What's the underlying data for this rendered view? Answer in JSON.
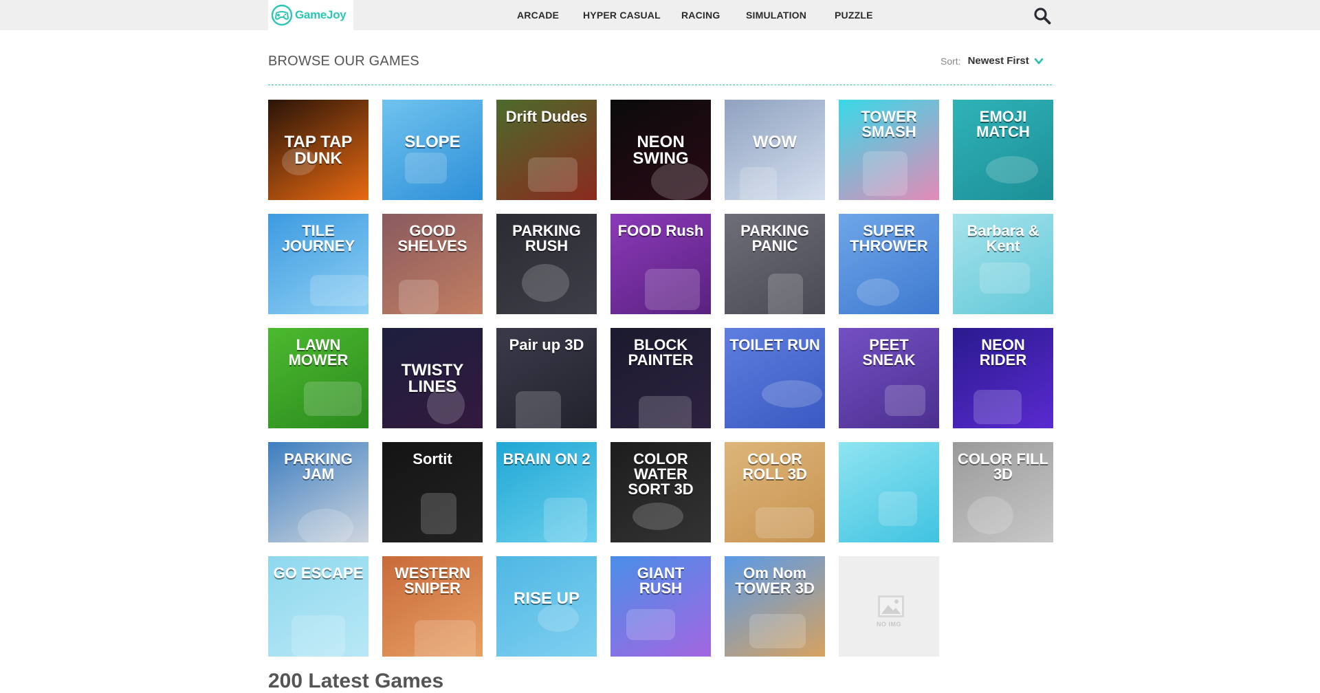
{
  "header": {
    "logo_text": "GameJoy",
    "nav": [
      "ARCADE",
      "HYPER CASUAL",
      "RACING",
      "SIMULATION",
      "PUZZLE"
    ],
    "search_icon": "search-icon"
  },
  "browse": {
    "title": "BROWSE OUR GAMES",
    "sort_label": "Sort:",
    "sort_value": "Newest First"
  },
  "games": [
    {
      "label": "TAP TAP DUNK",
      "bg": "#2a1408",
      "bg2": "#e86a12",
      "style": "mid"
    },
    {
      "label": "SLOPE",
      "bg": "#6fc3ee",
      "bg2": "#2e8fd8",
      "style": "mid"
    },
    {
      "label": "Drift Dudes",
      "bg": "#4c6b2c",
      "bg2": "#8b2a1e",
      "style": "top"
    },
    {
      "label": "NEON SWING",
      "bg": "#0b0b0b",
      "bg2": "#2a0a16",
      "style": "mid"
    },
    {
      "label": "WOW",
      "bg": "#8fa2c0",
      "bg2": "#d6e0ef",
      "style": "mid"
    },
    {
      "label": "TOWER SMASH",
      "bg": "#38d9e8",
      "bg2": "#e38ab6",
      "style": "top"
    },
    {
      "label": "EMOJI MATCH",
      "bg": "#2fb3b8",
      "bg2": "#1c8f96",
      "style": "top"
    },
    {
      "label": "TILE JOURNEY",
      "bg": "#3d9be0",
      "bg2": "#8fd0f4",
      "style": "top"
    },
    {
      "label": "GOOD SHELVES",
      "bg": "#8a5a5f",
      "bg2": "#c27f62",
      "style": "top"
    },
    {
      "label": "PARKING RUSH",
      "bg": "#2b2b33",
      "bg2": "#3e3e48",
      "style": "top"
    },
    {
      "label": "FOOD Rush",
      "bg": "#8b3ab8",
      "bg2": "#5a2180",
      "style": "top"
    },
    {
      "label": "PARKING PANIC",
      "bg": "#6e6e78",
      "bg2": "#4a4a54",
      "style": "top"
    },
    {
      "label": "SUPER THROWER",
      "bg": "#6fa6e8",
      "bg2": "#3e79cf",
      "style": "top"
    },
    {
      "label": "Barbara & Kent",
      "bg": "#a6e3ec",
      "bg2": "#61c8d8",
      "style": "top"
    },
    {
      "label": "LAWN MOWER",
      "bg": "#4cba2f",
      "bg2": "#2b8a1e",
      "style": "top"
    },
    {
      "label": "TWISTY LINES",
      "bg": "#1d1f3e",
      "bg2": "#33193d",
      "style": "mid"
    },
    {
      "label": "Pair up 3D",
      "bg": "#3a3a4a",
      "bg2": "#23232e",
      "style": "top"
    },
    {
      "label": "BLOCK PAINTER",
      "bg": "#1b1a2e",
      "bg2": "#2d2240",
      "style": "top"
    },
    {
      "label": "TOILET RUN",
      "bg": "#5e7ee0",
      "bg2": "#3b5ac2",
      "style": "top"
    },
    {
      "label": "PEET SNEAK",
      "bg": "#7450c4",
      "bg2": "#4b2f8e",
      "style": "top"
    },
    {
      "label": "NEON RIDER",
      "bg": "#2a1a8e",
      "bg2": "#5a2ad0",
      "style": "top"
    },
    {
      "label": "PARKING JAM",
      "bg": "#3d7ec0",
      "bg2": "#cfd6de",
      "style": "top"
    },
    {
      "label": "Sortit",
      "bg": "#141414",
      "bg2": "#222222",
      "style": "top"
    },
    {
      "label": "BRAIN ON 2",
      "bg": "#1fa7d4",
      "bg2": "#6cd0ee",
      "style": "top"
    },
    {
      "label": "COLOR WATER SORT 3D",
      "bg": "#1d1d1d",
      "bg2": "#333333",
      "style": "top"
    },
    {
      "label": "COLOR ROLL 3D",
      "bg": "#ddb57a",
      "bg2": "#c79350",
      "style": "top"
    },
    {
      "label": "",
      "bg": "#8fe4f0",
      "bg2": "#40c3e2",
      "style": "top"
    },
    {
      "label": "COLOR FILL 3D",
      "bg": "#9a9a9a",
      "bg2": "#c8c8c8",
      "style": "top"
    },
    {
      "label": "GO ESCAPE",
      "bg": "#8fd8ee",
      "bg2": "#b8e8f6",
      "style": "top"
    },
    {
      "label": "WESTERN SNIPER",
      "bg": "#c86a3a",
      "bg2": "#e8a064",
      "style": "top"
    },
    {
      "label": "RISE UP",
      "bg": "#4fb7e4",
      "bg2": "#7fd0f0",
      "style": "mid"
    },
    {
      "label": "GIANT RUSH",
      "bg": "#4a8ee8",
      "bg2": "#a366e0",
      "style": "top"
    },
    {
      "label": "Om Nom TOWER 3D",
      "bg": "#5a9ae8",
      "bg2": "#d7a260",
      "style": "top"
    },
    {
      "label": "NO IMG",
      "bg": "#eeeeee",
      "bg2": "#eeeeee",
      "style": "noimg"
    }
  ],
  "latest_heading": "200 Latest Games"
}
